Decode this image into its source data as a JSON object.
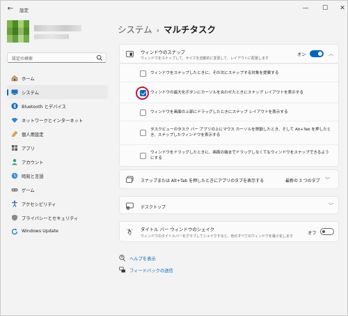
{
  "titlebar": {
    "back": "←",
    "title": "設定",
    "minimize": "—",
    "maximize": "☐",
    "close": "✕"
  },
  "search": {
    "placeholder": "設定の検索"
  },
  "nav": {
    "items": [
      {
        "label": "ホーム",
        "icon": "home-icon"
      },
      {
        "label": "システム",
        "icon": "system-icon",
        "active": true
      },
      {
        "label": "Bluetooth とデバイス",
        "icon": "bluetooth-icon"
      },
      {
        "label": "ネットワークとインターネット",
        "icon": "network-icon"
      },
      {
        "label": "個人用設定",
        "icon": "personalization-icon"
      },
      {
        "label": "アプリ",
        "icon": "apps-icon"
      },
      {
        "label": "アカウント",
        "icon": "account-icon"
      },
      {
        "label": "時刻と言語",
        "icon": "time-language-icon"
      },
      {
        "label": "ゲーム",
        "icon": "gaming-icon"
      },
      {
        "label": "アクセシビリティ",
        "icon": "accessibility-icon"
      },
      {
        "label": "プライバシーとセキュリティ",
        "icon": "privacy-icon"
      },
      {
        "label": "Windows Update",
        "icon": "windows-update-icon"
      }
    ]
  },
  "breadcrumb": {
    "parent": "システム",
    "separator": "›",
    "current": "マルチタスク"
  },
  "snap": {
    "title": "ウィンドウのスナップ",
    "subtitle": "ウィンドウをスナップして、サイズを自動的に変更して、レイアウトに配置します",
    "state_label": "オン",
    "options": [
      {
        "label": "ウィンドウをスナップしたときに、その次にスナップする対象を提案する",
        "checked": false
      },
      {
        "label": "ウィンドウの最大化ボタンにカーソルを合わせたときにスナップ レイアウトを表示する",
        "checked": true
      },
      {
        "label": "ウィンドウを画面の上部にドラッグしたときにスナップ レイアウトを表示する",
        "checked": false
      },
      {
        "label": "タスクビューのタスク バー アプリの上にマウス カーソルを移動したとき、そして Alt+Tab を押したとき、スナップしたウィンドウを表示する",
        "checked": false
      },
      {
        "label": "ウィンドウをドラッグしたときに、画面の端までドラッグしなくてもウィンドウをスナップできるようにする",
        "checked": false
      }
    ]
  },
  "alttab": {
    "title": "スナップまたは Alt+Tab を押したときにアプリのタブを表示する",
    "value": "最新の 3 つのタブ"
  },
  "desktops": {
    "title": "デスクトップ"
  },
  "shake": {
    "title": "タイトル バー ウィンドウのシェイク",
    "subtitle": "ウィンドウのタイトルバーをグラブしてシェイクすると、他のすべてのウィンドウを最小化します",
    "state_label": "オフ"
  },
  "links": {
    "help": "ヘルプを表示",
    "feedback": "フィードバックの送信"
  },
  "colors": {
    "accent": "#0067c0",
    "highlight": "#c0143c"
  }
}
